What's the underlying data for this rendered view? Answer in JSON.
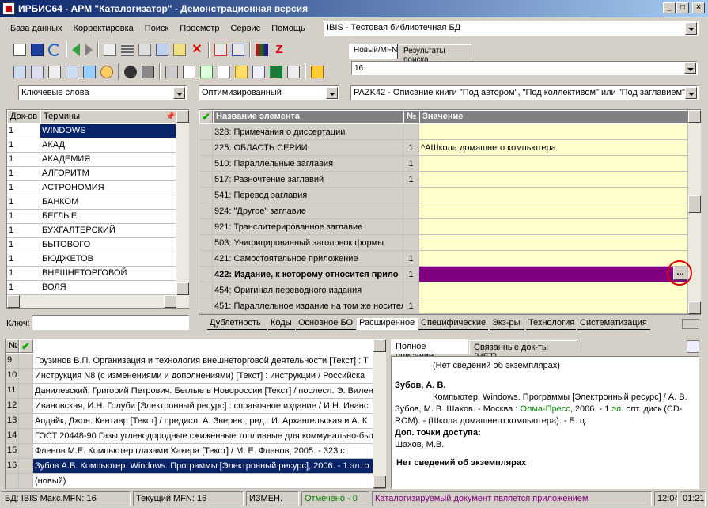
{
  "window": {
    "title": "ИРБИС64 - АРМ \"Каталогизатор\" - Демонстрационная версия"
  },
  "menu": [
    "База данных",
    "Корректировка",
    "Поиск",
    "Просмотр",
    "Сервис",
    "Помощь"
  ],
  "db_select": "IBIS - Тестовая библиотечная БД",
  "top_tabs": [
    "Новый/MFN",
    "Результаты поиска"
  ],
  "mfn_value": "16",
  "search_mode": "Ключевые слова",
  "opt_mode": "Оптимизированный",
  "worksheet": "PAZK42 - Описание книги \"Под автором\", \"Под коллективом\" или \"Под заглавием\"",
  "terms": {
    "col_docs": "Док-ов",
    "col_terms": "Термины",
    "key_label": "Ключ:",
    "items": [
      {
        "n": "1",
        "t": "WINDOWS"
      },
      {
        "n": "1",
        "t": "АКАД"
      },
      {
        "n": "1",
        "t": "АКАДЕМИЯ"
      },
      {
        "n": "1",
        "t": "АЛГОРИТМ"
      },
      {
        "n": "1",
        "t": "АСТРОНОМИЯ"
      },
      {
        "n": "1",
        "t": "БАНКОМ"
      },
      {
        "n": "1",
        "t": "БЕГЛЫЕ"
      },
      {
        "n": "1",
        "t": "БУХГАЛТЕРСКИЙ"
      },
      {
        "n": "1",
        "t": "БЫТОВОГО"
      },
      {
        "n": "1",
        "t": "БЮДЖЕТОВ"
      },
      {
        "n": "1",
        "t": "ВНЕШНЕТОРГОВОЙ"
      },
      {
        "n": "1",
        "t": "ВОЛЯ"
      }
    ]
  },
  "fields": {
    "col_name": "Название элемента",
    "col_no": "№",
    "col_value": "Значение",
    "items": [
      {
        "name": "328: Примечания о диссертации",
        "no": "",
        "value": ""
      },
      {
        "name": "225: ОБЛАСТЬ СЕРИИ",
        "no": "1",
        "value": "^AШкола домашнего компьютера"
      },
      {
        "name": "510: Параллельные заглавия",
        "no": "1",
        "value": ""
      },
      {
        "name": "517: Разночтение заглавий",
        "no": "1",
        "value": ""
      },
      {
        "name": "541: Перевод заглавия",
        "no": "",
        "value": ""
      },
      {
        "name": "924: \"Другое\" заглавие",
        "no": "",
        "value": ""
      },
      {
        "name": "921: Транслитерированное заглавие",
        "no": "",
        "value": ""
      },
      {
        "name": "503: Унифицированный заголовок формы",
        "no": "",
        "value": ""
      },
      {
        "name": "421: Самостоятельное приложение",
        "no": "1",
        "value": ""
      },
      {
        "name": "422: Издание, к которому относится прило",
        "no": "1",
        "value": ""
      },
      {
        "name": "454: Оригинал переводного издания",
        "no": "",
        "value": ""
      },
      {
        "name": "451: Параллельное издание на том же носител",
        "no": "1",
        "value": ""
      }
    ],
    "ellipsis": "..."
  },
  "bottom_tabs": [
    "Дублетность",
    "Коды",
    "Основное БО",
    "Расширенное",
    "Специфические",
    "Экз-ры",
    "Технология",
    "Систематизация"
  ],
  "records": {
    "col_no": "№",
    "items": [
      {
        "n": "9",
        "t": "Грузинов В.П. Организация и технология внешнеторговой деятельности [Текст] : Т"
      },
      {
        "n": "10",
        "t": "Инструкция N8   (с изменениями и дополнениями) [Текст] : инструкции / Российска"
      },
      {
        "n": "11",
        "t": "Данилевский, Григорий Петрович. Беглые в Новороссии [Текст] / послесл. Э. Вилен"
      },
      {
        "n": "12",
        "t": "Ивановская, И.Н. Голуби [Электронный ресурс] : справочное издание / И.Н. Иванс"
      },
      {
        "n": "13",
        "t": "Апдайк, Джон. Кентавр [Текст] / предисл. А. Зверев ; ред.: И. Архангельская и А. К"
      },
      {
        "n": "14",
        "t": "ГОСТ 20448-90 Газы углеводородные сжиженные топливные для коммунально-быт"
      },
      {
        "n": "15",
        "t": "Фленов М.Е. Компьютер глазами Хакера [Текст] / М. Е. Фленов, 2005. - 323 с."
      },
      {
        "n": "16",
        "t": "Зубов А.В. Компьютер. Windows. Программы [Электронный ресурс], 2006. - 1 эл. о"
      },
      {
        "n": "",
        "t": "(новый)"
      }
    ]
  },
  "desc_tabs": [
    "Полное описание",
    "Связанные док-ты (НЕТ)"
  ],
  "description": {
    "line1": "(Нет сведений об экземплярах)",
    "author": "Зубов, А. В.",
    "body1": "Компьютер. Windows. Программы [Электронный ресурс] / А. В. Зубов, М. В. Шахов. - Москва : ",
    "publisher": "Олма-Пресс",
    "body2": ", 2006. - 1 ",
    "el": "эл.",
    "body3": " опт. диск (CD-ROM). - (Школа домашнего компьютера). - Б. ц.",
    "access_label": "Доп. точки доступа:",
    "access_value": "Шахов, М.В.",
    "no_copies": "Нет сведений об экземплярах"
  },
  "status": {
    "db": "БД: IBIS Макс.MFN: 16",
    "current": "Текущий MFN: 16",
    "changed": "ИЗМЕН.",
    "marked": "Отмечено - 0",
    "message": "Каталогизируемый документ является приложением",
    "time": "12:04",
    "date": "01:21"
  },
  "colors": {
    "selection": "#0a246a",
    "highlight_row": "#800080",
    "value_bg": "#ffffcc",
    "marked": "#008000",
    "message": "#800080",
    "circle": "#e00000"
  }
}
